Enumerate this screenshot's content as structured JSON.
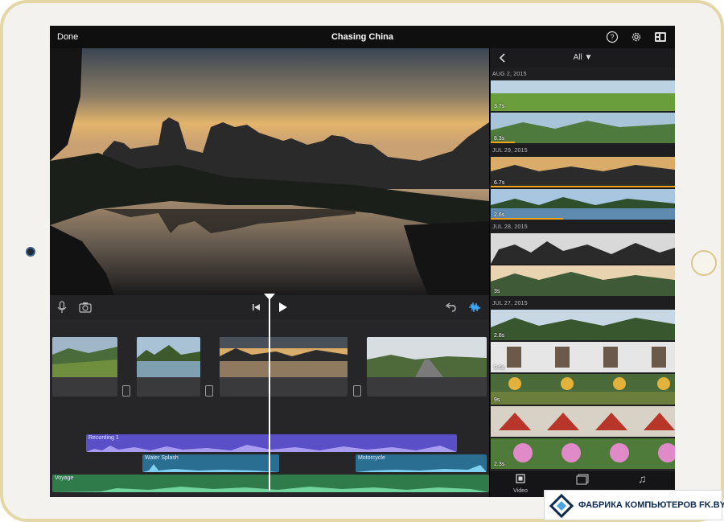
{
  "topbar": {
    "done_label": "Done",
    "project_title": "Chasing China",
    "icons": [
      "help-icon",
      "settings-icon",
      "project-view-icon"
    ]
  },
  "viewer": {
    "description_icon": "video-preview"
  },
  "controls": {
    "icons": [
      "microphone-icon",
      "camera-icon",
      "rewind-to-start-icon",
      "play-icon",
      "undo-icon",
      "audio-waveform-icon"
    ]
  },
  "timeline": {
    "audio_tracks": [
      {
        "label": "Recording 1",
        "color": "#5b4fc8"
      },
      {
        "label": "Water Splash",
        "color": "#2a6f92"
      },
      {
        "label": "Motorcycle",
        "color": "#2a6f92"
      },
      {
        "label": "Voyage",
        "color": "#2f7b4a"
      }
    ]
  },
  "browser": {
    "filter_label": "All",
    "sections": [
      {
        "date": "AUG 2, 2015",
        "clips": [
          {
            "duration": "3.7s"
          },
          {
            "duration": "8.3s"
          }
        ]
      },
      {
        "date": "JUL 29, 2015",
        "clips": [
          {
            "duration": "6.7s"
          },
          {
            "duration": "2.6s"
          }
        ]
      },
      {
        "date": "JUL 28, 2015",
        "clips": [
          {
            "duration": ""
          },
          {
            "duration": "3s"
          }
        ]
      },
      {
        "date": "JUL 27, 2015",
        "clips": [
          {
            "duration": "2.8s"
          },
          {
            "duration": "9.6s"
          },
          {
            "duration": "9s"
          },
          {
            "duration": ""
          },
          {
            "duration": "2.3s"
          }
        ]
      }
    ],
    "tabs": [
      {
        "label": "Video"
      },
      {
        "label": ""
      },
      {
        "label": ""
      }
    ]
  },
  "watermark": {
    "text": "ФАБРИКА КОМПЬЮТЕРОВ FK.BY"
  },
  "colors": {
    "accent": "#f0a21b",
    "background": "#1c1c1e",
    "device_frame": "#e4d7a6"
  }
}
